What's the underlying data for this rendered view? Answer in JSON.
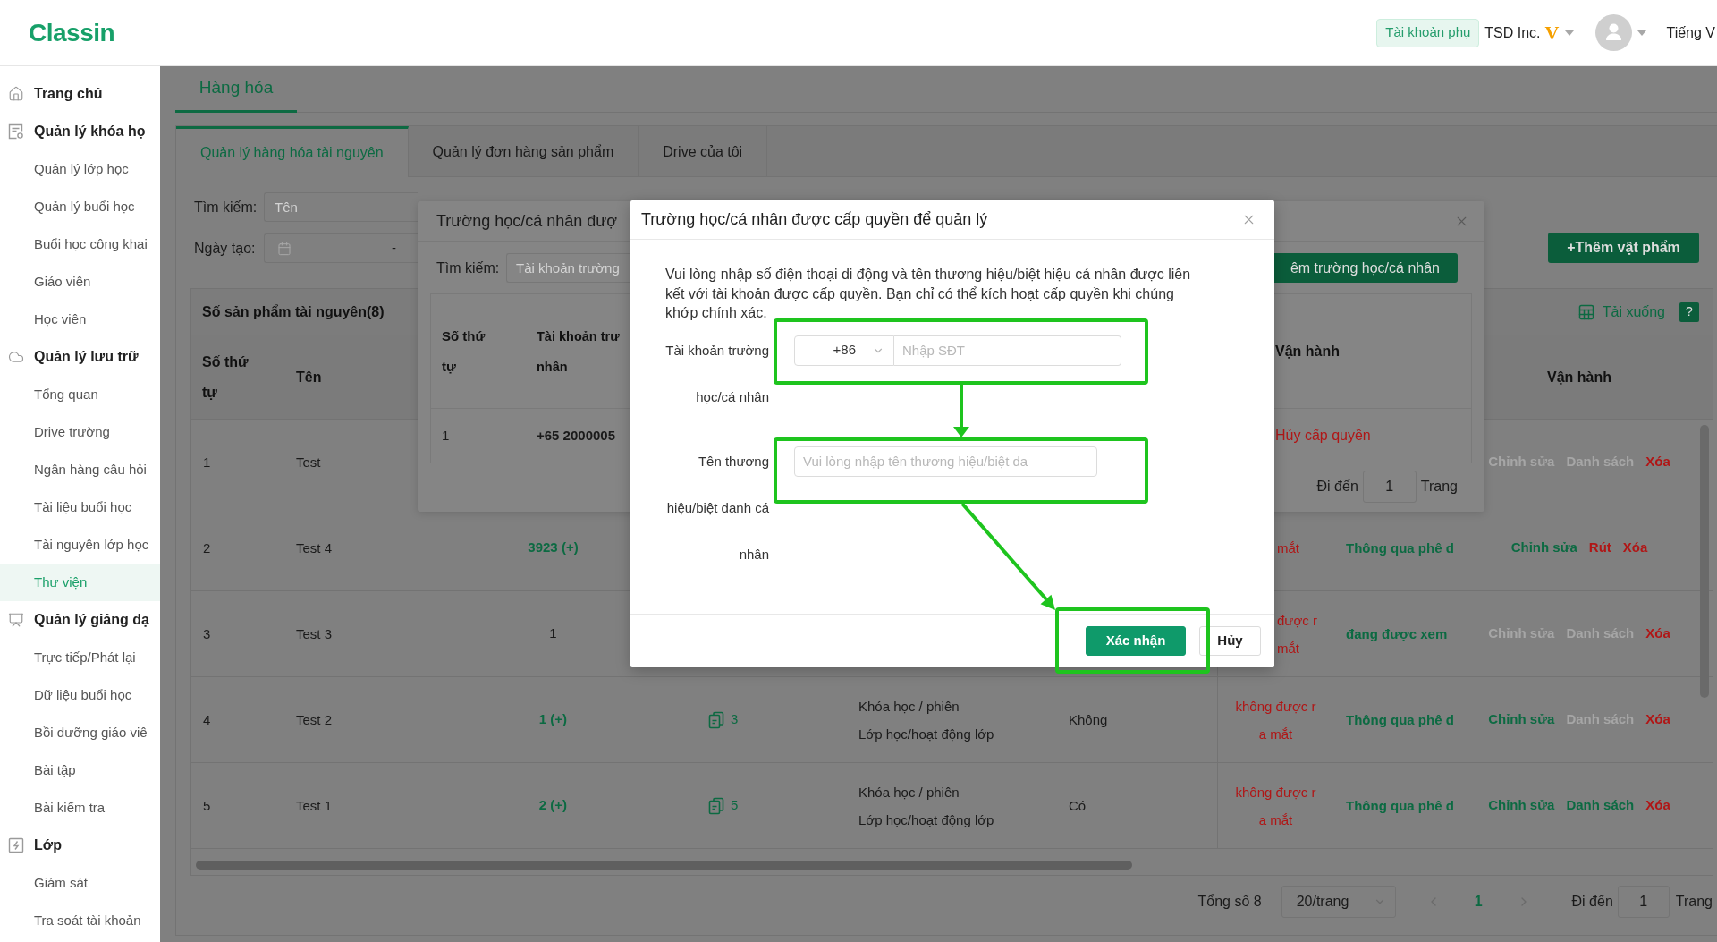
{
  "header": {
    "logo": "Classin",
    "account_badge": "Tài khoản phụ",
    "organization": "TSD Inc.",
    "vip_mark": "V",
    "language": "Tiếng V"
  },
  "sidebar": {
    "groups": [
      {
        "title": "Trang chủ"
      },
      {
        "title": "Quản lý khóa họ",
        "items": [
          {
            "label": "Quản lý lớp học",
            "selected": false
          },
          {
            "label": "Quản lý buổi học",
            "selected": false
          },
          {
            "label": "Buổi học công khai",
            "selected": false
          },
          {
            "label": "Giáo viên",
            "selected": false
          },
          {
            "label": "Học viên",
            "selected": false
          }
        ]
      },
      {
        "title": "Quản lý lưu trữ",
        "items": [
          {
            "label": "Tổng quan",
            "selected": false
          },
          {
            "label": "Drive trường",
            "selected": false
          },
          {
            "label": "Ngân hàng câu hỏi",
            "selected": false
          },
          {
            "label": "Tài liệu buổi học",
            "selected": false
          },
          {
            "label": "Tài nguyên lớp học",
            "selected": false
          },
          {
            "label": "Thư viện",
            "selected": true
          }
        ]
      },
      {
        "title": "Quản lý giảng dạ",
        "items": [
          {
            "label": "Trực tiếp/Phát lại",
            "selected": false
          },
          {
            "label": "Dữ liệu buổi học",
            "selected": false
          },
          {
            "label": "Bồi dưỡng giáo viê",
            "selected": false
          },
          {
            "label": "Bài tập",
            "selected": false
          },
          {
            "label": "Bài kiểm tra",
            "selected": false
          }
        ]
      },
      {
        "title": "Lớp",
        "items": [
          {
            "label": "Giám sát",
            "selected": false
          },
          {
            "label": "Tra soát tài khoản",
            "selected": false
          }
        ]
      }
    ]
  },
  "goods": {
    "page_tabs": [
      {
        "label": "Hàng hóa",
        "selected": true
      }
    ],
    "sub_tabs": [
      {
        "label": "Quản lý hàng hóa tài nguyên",
        "selected": true
      },
      {
        "label": "Quản lý đơn hàng sản phẩm",
        "selected": false
      },
      {
        "label": "Drive của tôi",
        "selected": false
      }
    ],
    "filters": [
      {
        "kind": "text",
        "label": "Tìm kiếm:",
        "placeholder": "Tên"
      },
      {
        "kind": "date_range",
        "label": "Ngày tạo:",
        "separator": "-"
      }
    ],
    "add_button": "+Thêm vật phẩm",
    "table": {
      "title": "Số sản phẩm tài nguyên(8)",
      "download": "Tải xuống",
      "help": "?",
      "headers": {
        "column_1": "Số thứ tự",
        "column_2": "Tên",
        "actions": "Vận hành"
      },
      "rows": [
        {
          "column_1": "1",
          "column_2": "Test",
          "actions": [
            {
              "label": "Chỉnh sửa",
              "kind": "normal",
              "disabled": true
            },
            {
              "label": "Danh sách",
              "kind": "normal",
              "disabled": true
            },
            {
              "label": "Xóa",
              "kind": "danger",
              "disabled": false
            }
          ]
        },
        {
          "column_1": "2",
          "column_2": "Test 4",
          "column_3": {
            "kind": "link",
            "text": "3923 (+)"
          },
          "column_7": {
            "kind": "cut",
            "lines": [
              "mắt"
            ]
          },
          "column_8": "Thông qua phê d",
          "actions": [
            {
              "label": "Chỉnh sửa",
              "kind": "normal",
              "disabled": false
            },
            {
              "label": "Rút",
              "kind": "danger",
              "disabled": false
            },
            {
              "label": "Xóa",
              "kind": "danger",
              "disabled": false
            }
          ]
        },
        {
          "column_1": "3",
          "column_2": "Test 3",
          "column_3": {
            "kind": "plain",
            "text": "1"
          },
          "column_7": {
            "kind": "cut",
            "lines": [
              "được r",
              "mắt"
            ]
          },
          "column_8": "đang được xem",
          "actions": [
            {
              "label": "Chỉnh sửa",
              "kind": "normal",
              "disabled": true
            },
            {
              "label": "Danh sách",
              "kind": "normal",
              "disabled": true
            },
            {
              "label": "Xóa",
              "kind": "danger",
              "disabled": false
            }
          ]
        },
        {
          "column_1": "4",
          "column_2": "Test 2",
          "column_3": {
            "kind": "link",
            "text": "1 (+)"
          },
          "column_4": "3",
          "column_5": [
            "Khóa học / phiên",
            "Lớp học/hoạt động lớp"
          ],
          "column_6": "Không",
          "column_7": {
            "kind": "full",
            "lines": [
              "không được r",
              "a mắt"
            ]
          },
          "column_8": "Thông qua phê d",
          "actions": [
            {
              "label": "Chỉnh sửa",
              "kind": "normal",
              "disabled": false
            },
            {
              "label": "Danh sách",
              "kind": "normal",
              "disabled": true
            },
            {
              "label": "Xóa",
              "kind": "danger",
              "disabled": false
            }
          ]
        },
        {
          "column_1": "5",
          "column_2": "Test 1",
          "column_3": {
            "kind": "link",
            "text": "2 (+)"
          },
          "column_4": "5",
          "column_5": [
            "Khóa học / phiên",
            "Lớp học/hoạt động lớp"
          ],
          "column_6": "Có",
          "column_7": {
            "kind": "full",
            "lines": [
              "không được r",
              "a mắt"
            ]
          },
          "column_8": "Thông qua phê d",
          "actions": [
            {
              "label": "Chỉnh sửa",
              "kind": "normal",
              "disabled": false
            },
            {
              "label": "Danh sách",
              "kind": "normal",
              "disabled": false
            },
            {
              "label": "Xóa",
              "kind": "danger",
              "disabled": false
            }
          ]
        }
      ]
    },
    "pagination": {
      "total": "Tổng số 8",
      "page_size": "20/trang",
      "pages": [
        {
          "label": "1",
          "selected": true
        }
      ],
      "goto_label": "Đi đến",
      "goto_value": "1",
      "goto_suffix": "Trang"
    }
  },
  "authorized_list": {
    "title": "Trường học/cá nhân đượ",
    "search_label": "Tìm kiếm:",
    "search_placeholder": "Tài khoản trường",
    "add_button": "êm trường học/cá nhân",
    "headers": {
      "column_1": "Số thứ tự",
      "column_2": [
        "Tài khoản trư",
        "nhân"
      ],
      "actions": "Vận hành"
    },
    "rows": [
      {
        "column_1": "1",
        "column_2": "+65 2000005",
        "action": "Hủy cấp quyền"
      }
    ],
    "pagination": {
      "goto_label": "Đi đến",
      "goto_value": "1",
      "goto_suffix": "Trang"
    }
  },
  "dialog": {
    "title": "Trường học/cá nhân được cấp quyền để quản lý",
    "message": "Vui lòng nhập số điện thoại di động và tên thương hiệu/biệt hiệu cá nhân được liên kết với tài khoản được cấp quyền. Bạn chỉ có thể kích hoạt cấp quyền khi chúng khớp chính xác.",
    "fields": [
      {
        "kind": "phone",
        "label_lines": [
          "Tài khoản trường",
          "học/cá nhân"
        ],
        "country_code": "+86",
        "placeholder": "Nhập SĐT"
      },
      {
        "kind": "text",
        "label_lines": [
          "Tên thương",
          "hiệu/biệt danh cá",
          "nhân"
        ],
        "placeholder": "Vui lòng nhập tên thương hiệu/biệt da"
      }
    ],
    "buttons": [
      {
        "label": "Xác nhận",
        "kind": "primary"
      },
      {
        "label": "Hủy",
        "kind": "default"
      }
    ]
  }
}
